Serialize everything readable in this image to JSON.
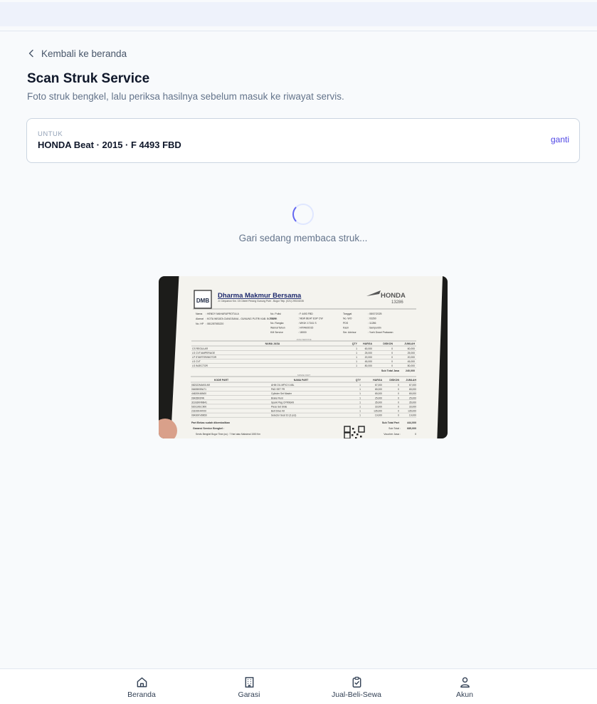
{
  "back_link": {
    "label": "Kembali ke beranda"
  },
  "page": {
    "title": "Scan Struk Service",
    "subtitle": "Foto struk bengkel, lalu periksa hasilnya sebelum masuk ke riwayat servis."
  },
  "vehicle": {
    "label": "UNTUK",
    "name": "HONDA Beat · 2015 · F 4493 FBD",
    "change_label": "ganti"
  },
  "scan": {
    "status": "Gari sedang membaca struk..."
  },
  "receipt": {
    "shop_name": "Dharma Makmur Bersama",
    "shop_address": "Jl. Cimpaeun Km. 15 Cibeet Perang Gunung Putri - Bogor Telp. (021) 2933 8235",
    "shop_logo": "DMB",
    "brand": "HONDA",
    "brand_number": "13286",
    "customer_labels": [
      "Nama",
      "Alamat",
      "No. HP"
    ],
    "customer_values": [
      ": HENDY MAHARUPROTULA",
      ": KOTA WISATA CIANGSANA - GUNUNG PUTRI KAB. BOGOR",
      ": 081287553220"
    ],
    "vehicle_labels": [
      "No. Polisi",
      "Nama",
      "No. Rangka",
      "Warna/Tahun",
      "KM Service"
    ],
    "vehicle_values": [
      ": F 4493 FBD",
      ": NEW BEAT ESP CW",
      ": MH1K 17161 S",
      ": HITAM/2015",
      ": 18000"
    ],
    "invoice_labels": [
      "Tanggal",
      "No. WO",
      "PDS",
      "Kasir",
      "Ser. Advisor"
    ],
    "invoice_values": [
      ": 08/07/2025",
      ": 03260",
      ": 11286",
      ": Sampurdin",
      ": Yoeh Dwari Pratawan"
    ],
    "jasa_section": "JASA SERVICE",
    "jasa_headers": [
      "NAMA JASA",
      "QTY",
      "HARGA",
      "DISKON",
      "JUMLAH"
    ],
    "jasa_rows": [
      [
        "CS REGULAR",
        "1",
        "60,000",
        "0",
        "60,000"
      ],
      [
        "LS CVT/AMPERAGE",
        "1",
        "25,000",
        "0",
        "25,000"
      ],
      [
        "LP STARTER/MOTOR",
        "1",
        "20,000",
        "0",
        "20,000"
      ],
      [
        "LS CVT",
        "1",
        "45,000",
        "0",
        "45,000"
      ],
      [
        "LS INJECTOR",
        "1",
        "80,000",
        "0",
        "80,000"
      ]
    ],
    "jasa_subtotal_label": "Sub Total Jasa",
    "jasa_subtotal": "240,000",
    "part_section": "SPARE PART",
    "part_headers": [
      "KODE PART",
      "NAMA PART",
      "QTY",
      "HARGA",
      "DISKON",
      "JUMLAH"
    ],
    "part_rows": [
      [
        "082322MAK0LN9",
        "AHM OIL MPX2 0.65L",
        "1",
        "67,000",
        "0",
        "67,000"
      ],
      [
        "06455K59A71",
        "PAD SET FR",
        "1",
        "65,000",
        "0",
        "65,000"
      ],
      [
        "44620K46N00",
        "Cylinder Set Master",
        "1",
        "65,000",
        "0",
        "65,000"
      ],
      [
        "06435K0PAI",
        "Brake Fluid",
        "1",
        "25,000",
        "0",
        "25,000"
      ],
      [
        "31916KRM841",
        "Spark Plug CPR9EA9",
        "1",
        "35,000",
        "0",
        "35,000"
      ],
      [
        "53011KEC900",
        "Piece Set Slide",
        "1",
        "33,000",
        "0",
        "33,000"
      ],
      [
        "23100K44V00",
        "Belt Drive Kit",
        "1",
        "135,000",
        "0",
        "135,000"
      ],
      [
        "06430KVBN50",
        "Selector Seat 10 (3 pcs)",
        "1",
        "19,000",
        "0",
        "19,000"
      ]
    ],
    "part_subtotal_label": "Sub Total Part",
    "part_subtotal": "444,000",
    "note": "Part Bekas sudah dikembalikan",
    "warranty_title": "Garansi Service Bengkel :",
    "warranty_line": "Servis Bengkel Bogor Time (us) : 7 Hari atau Maksimal 1500 Km",
    "total_label": "Sub Total :",
    "total_value": "685,000",
    "voucher_label": "Voucher Jasa :",
    "voucher_value": "0"
  },
  "bottom_nav": [
    {
      "label": "Beranda",
      "icon": "home-icon"
    },
    {
      "label": "Garasi",
      "icon": "building-icon"
    },
    {
      "label": "Jual-Beli-Sewa",
      "icon": "clipboard-check-icon"
    },
    {
      "label": "Akun",
      "icon": "user-icon"
    }
  ],
  "colors": {
    "accent": "#4f46e5",
    "background": "#f8fafc",
    "topbar": "#eef2fb",
    "text_muted": "#64748b"
  }
}
